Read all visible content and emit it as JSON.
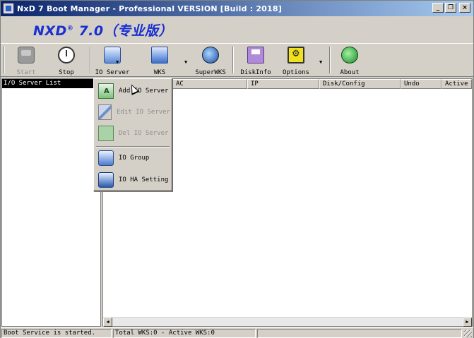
{
  "window": {
    "title": "NxD 7 Boot Manager - Professional VERSION [Build : 2018]",
    "brand": "NXD",
    "brand_reg": "®",
    "brand_version": " 7.0（专业版）"
  },
  "toolbar": {
    "start": "Start",
    "stop": "Stop",
    "io_server": "IO Server",
    "wks": "WKS",
    "superwks": "SuperWKS",
    "diskinfo": "DiskInfo",
    "options": "Options",
    "about": "About"
  },
  "left_panel": {
    "header": "I/O Server List"
  },
  "grid": {
    "columns": [
      "",
      "AC",
      "IP",
      "Disk/Config",
      "Undo",
      "Active"
    ]
  },
  "menu": {
    "items": [
      {
        "label": "Add IO Server",
        "enabled": true
      },
      {
        "label": "Edit IO Server",
        "enabled": false
      },
      {
        "label": "Del IO Server",
        "enabled": false
      },
      {
        "label": "IO Group",
        "enabled": true
      },
      {
        "label": "IO HA Setting",
        "enabled": true
      }
    ]
  },
  "status": {
    "service": "Boot Service is started.",
    "counts": "Total WKS:0 - Active WKS:0",
    "extra": ""
  },
  "colors": {
    "titlebar_start": "#0a246a",
    "titlebar_end": "#a6caf0",
    "brand": "#1a2fd0",
    "face": "#d4d0c8"
  }
}
